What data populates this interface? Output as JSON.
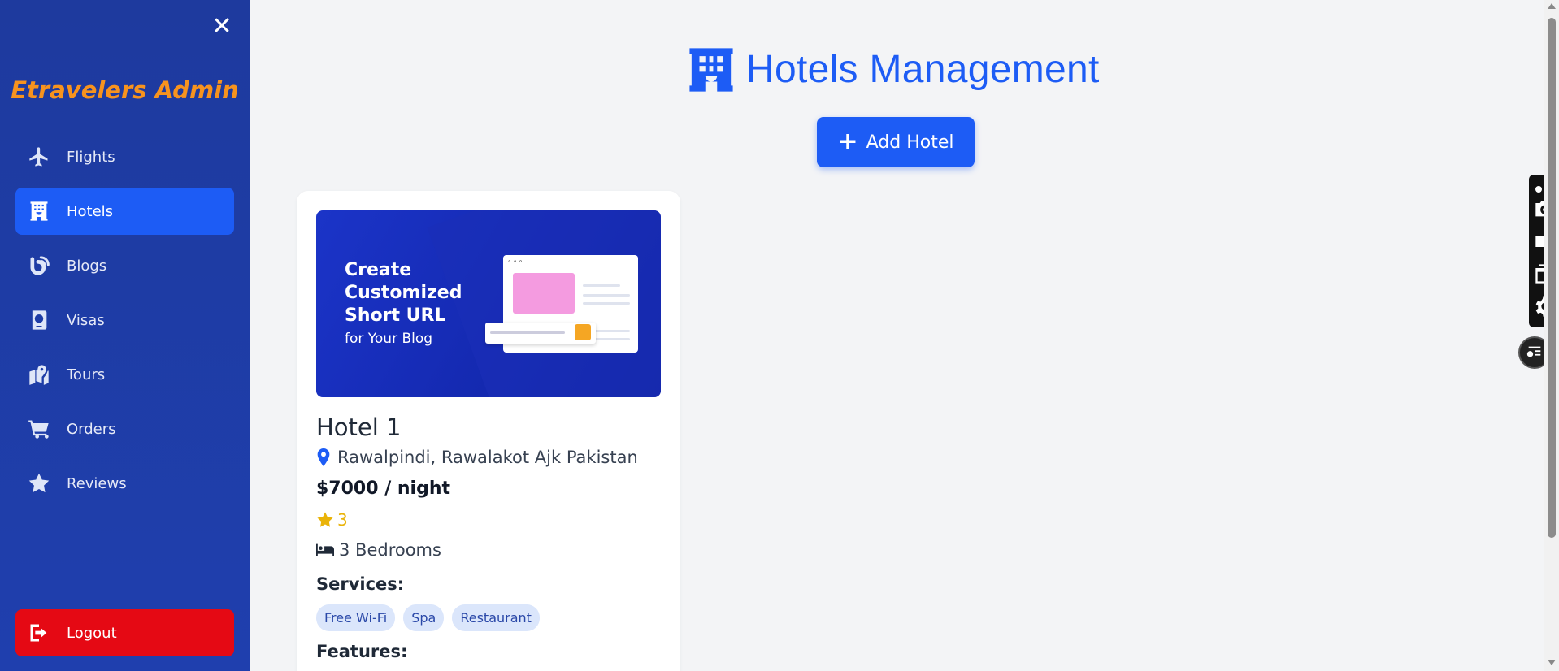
{
  "sidebar": {
    "brand": "Etravelers Admin",
    "items": [
      {
        "label": "Flights",
        "icon": "plane-icon",
        "active": false
      },
      {
        "label": "Hotels",
        "icon": "hotel-icon",
        "active": true
      },
      {
        "label": "Blogs",
        "icon": "blog-icon",
        "active": false
      },
      {
        "label": "Visas",
        "icon": "passport-icon",
        "active": false
      },
      {
        "label": "Tours",
        "icon": "map-icon",
        "active": false
      },
      {
        "label": "Orders",
        "icon": "cart-icon",
        "active": false
      },
      {
        "label": "Reviews",
        "icon": "star-icon",
        "active": false
      }
    ],
    "logout_label": "Logout"
  },
  "main": {
    "title": "Hotels Management",
    "add_button_label": "Add Hotel"
  },
  "hotel_card": {
    "image_text": {
      "line1": "Create",
      "line2": "Customized",
      "line3": "Short URL",
      "line4": "for Your Blog"
    },
    "name": "Hotel 1",
    "location": "Rawalpindi, Rawalakot Ajk Pakistan",
    "price": "$7000 / night",
    "rating": "3",
    "bedrooms": "3 Bedrooms",
    "services_label": "Services:",
    "services": [
      "Free Wi-Fi",
      "Spa",
      "Restaurant"
    ],
    "features_label": "Features:"
  },
  "colors": {
    "accent": "#1d5cf5",
    "sidebar_bg": "#1e3a9e",
    "brand": "#f7931e",
    "logout": "#e50914"
  }
}
